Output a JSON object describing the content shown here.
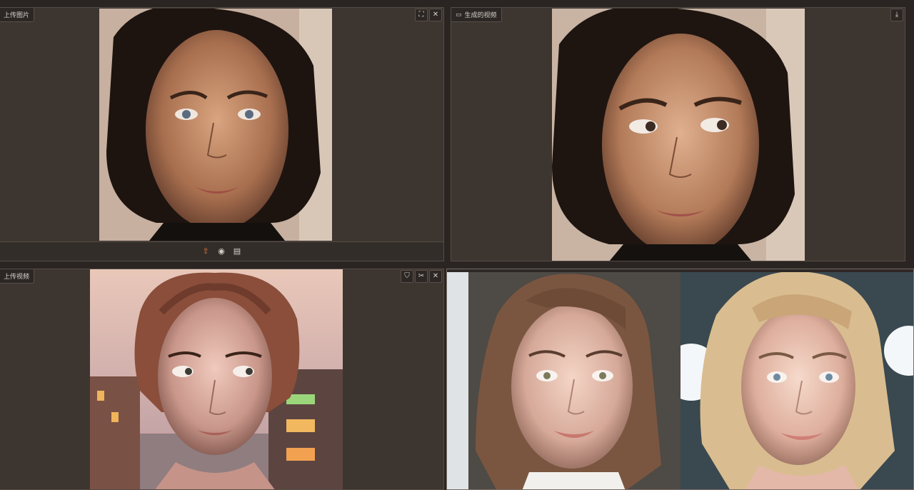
{
  "panels": {
    "upload_image": {
      "label": "上传图片"
    },
    "generated_video": {
      "label": "生成的视频"
    },
    "upload_video": {
      "label": "上传视频"
    }
  },
  "icons": {
    "fullscreen": "fullscreen-icon",
    "close": "close-icon",
    "download": "download-icon",
    "upload": "upload-icon",
    "webcam": "webcam-icon",
    "clipboard": "clipboard-icon",
    "video": "video-icon",
    "shield": "shield-icon",
    "scissors": "scissors-icon"
  },
  "colors": {
    "background": "#2a2522",
    "panel": "#3d3530",
    "accent_orange": "#e07b39"
  }
}
